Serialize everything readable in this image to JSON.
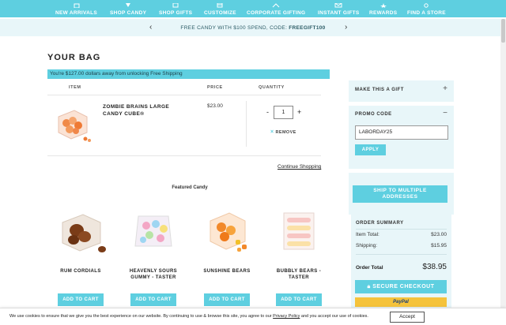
{
  "nav": {
    "items": [
      {
        "label": "NEW ARRIVALS",
        "icon": "bag-icon"
      },
      {
        "label": "SHOP CANDY",
        "icon": "candy-icon"
      },
      {
        "label": "SHOP GIFTS",
        "icon": "gift-icon"
      },
      {
        "label": "CUSTOMIZE",
        "icon": "calendar-icon"
      },
      {
        "label": "CORPORATE GIFTING",
        "icon": "house-icon"
      },
      {
        "label": "INSTANT GIFTS",
        "icon": "envelope-icon"
      },
      {
        "label": "REWARDS",
        "icon": "star-icon"
      },
      {
        "label": "FIND A STORE",
        "icon": "location-icon"
      }
    ]
  },
  "promo": {
    "text": "FREE CANDY WITH $100 SPEND, CODE: ",
    "code": "FREEGIFT100",
    "prev": "‹",
    "next": "›"
  },
  "bag": {
    "title": "YOUR BAG",
    "ship_msg": "You're $127.00 dollars away from unlocking Free Shipping",
    "headers": {
      "item": "ITEM",
      "price": "PRICE",
      "quantity": "QUANTITY"
    },
    "line_item": {
      "name": "ZOMBIE BRAINS LARGE CANDY CUBE®",
      "price": "$23.00",
      "qty": "1",
      "minus": "-",
      "plus": "+",
      "remove": "REMOVE"
    },
    "continue": "Continue Shopping"
  },
  "featured": {
    "title": "Featured Candy",
    "products": [
      {
        "name": "RUM CORDIALS",
        "button": "ADD TO CART",
        "color": "#7a3c18"
      },
      {
        "name": "HEAVENLY SOURS GUMMY - TASTER",
        "button": "ADD TO CART",
        "color": "#f3a6c5"
      },
      {
        "name": "SUNSHINE BEARS",
        "button": "ADD TO CART",
        "color": "#f2892a"
      },
      {
        "name": "BUBBLY BEARS - TASTER",
        "button": "ADD TO CART",
        "color": "#f7c6c3"
      }
    ]
  },
  "sidebar": {
    "gift": "MAKE THIS A GIFT",
    "gift_glyph": "+",
    "promo_title": "PROMO CODE",
    "promo_glyph": "−",
    "promo_value": "LABORDAY25",
    "apply": "APPLY",
    "multi_line1": "SHIP TO MULTIPLE",
    "multi_line2": "ADDRESSES",
    "summary": {
      "title": "ORDER SUMMARY",
      "item_total_label": "Item Total:",
      "item_total": "$23.00",
      "shipping_label": "Shipping:",
      "shipping": "$15.95",
      "order_total_label": "Order Total",
      "order_total": "$38.95"
    },
    "checkout": "SECURE CHECKOUT",
    "paypal": "PayPal"
  },
  "cookie": {
    "text_before": "We use cookies to ensure that we give you the best experience on our website. By continuing to use & browse this site, you agree to our ",
    "link": "Privacy Policy",
    "text_after": " and you accept our use of cookies.",
    "accept": "Accept"
  },
  "colors": {
    "accent": "#5ecfe0",
    "panel": "#e8f6f9"
  }
}
